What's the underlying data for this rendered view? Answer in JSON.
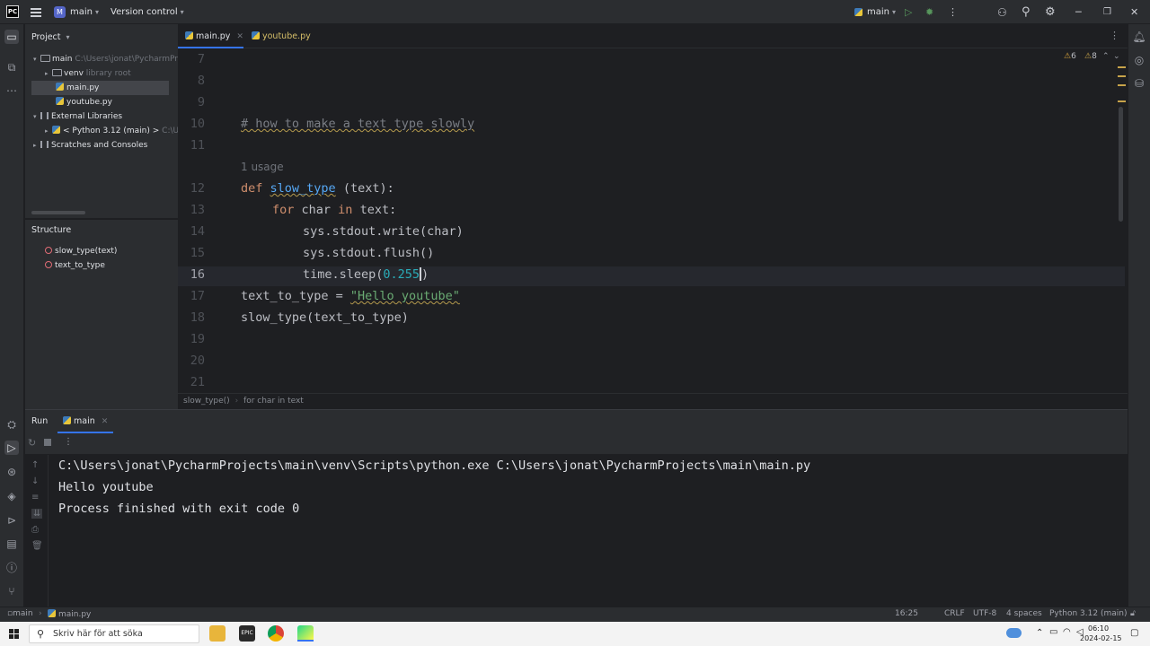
{
  "titlebar": {
    "project_badge": "M",
    "project_name": "main",
    "vcs_label": "Version control",
    "run_config": "main"
  },
  "project_panel": {
    "title": "Project",
    "tree": [
      {
        "label": "main",
        "hint": "C:\\Users\\jonat\\PycharmProjects\\main"
      },
      {
        "label": "venv",
        "hint": "library root"
      },
      {
        "label": "main.py"
      },
      {
        "label": "youtube.py"
      },
      {
        "label": "External Libraries"
      },
      {
        "label": "< Python 3.12 (main) >",
        "hint": "C:\\Us"
      },
      {
        "label": "Scratches and Consoles"
      }
    ]
  },
  "structure_panel": {
    "title": "Structure",
    "items": [
      "slow_type(text)",
      "text_to_type"
    ]
  },
  "tabs": [
    {
      "label": "main.py",
      "active": true
    },
    {
      "label": "youtube.py",
      "active": false
    }
  ],
  "editor": {
    "warnings": "6",
    "weak_warnings": "8",
    "line_numbers": [
      "7",
      "8",
      "9",
      "10",
      "11",
      "12",
      "13",
      "14",
      "15",
      "16",
      "17",
      "18",
      "19",
      "20",
      "21"
    ],
    "usage_hint": "1 usage",
    "lines": {
      "comment": "# how to make a text type slowly",
      "def_kw": "def",
      "def_name": "slow_type",
      "def_rest": " (text):",
      "for_kw": "for",
      "for_var": " char ",
      "in_kw": "in",
      "for_rest": " text:",
      "write": "sys.stdout.write(char)",
      "flush": "sys.stdout.flush()",
      "sleep_pre": "time.sleep(",
      "sleep_num": "0.255",
      "sleep_post": ")",
      "assign_pre": "text_to_type = ",
      "assign_str": "\"Hello youtube\"",
      "call": "slow_type(text_to_type)"
    }
  },
  "breadcrumb": [
    "slow_type()",
    "for char in text"
  ],
  "run_panel": {
    "title": "Run",
    "tab": "main",
    "output": [
      "C:\\Users\\jonat\\PycharmProjects\\main\\venv\\Scripts\\python.exe C:\\Users\\jonat\\PycharmProjects\\main\\main.py",
      "Hello youtube",
      "Process finished with exit code 0"
    ]
  },
  "statusbar": {
    "project": "main",
    "file": "main.py",
    "position": "16:25",
    "line_sep": "CRLF",
    "encoding": "UTF-8",
    "indent": "4 spaces",
    "interpreter": "Python 3.12 (main)"
  },
  "taskbar": {
    "search_placeholder": "Skriv här för att söka",
    "time": "06:10",
    "date": "2024-02-15"
  },
  "colors": {
    "keyword": "#cf8e6d",
    "function": "#56a8f5",
    "string": "#6aab73",
    "number": "#2aacb8",
    "accent": "#3574f0"
  }
}
